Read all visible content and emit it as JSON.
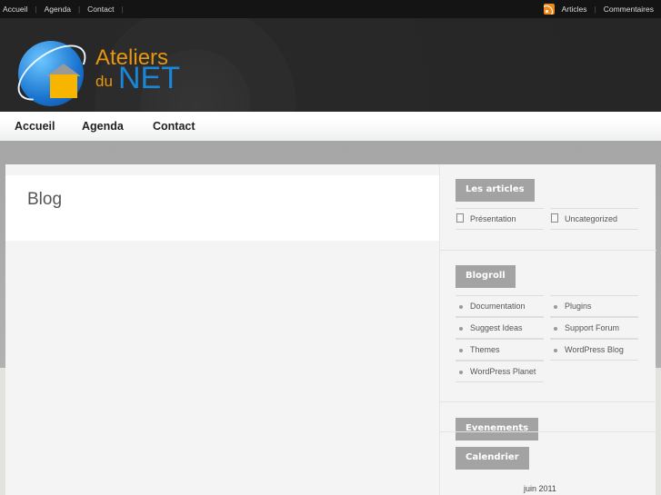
{
  "topbar": {
    "left": [
      "Accueil",
      "Agenda",
      "Contact"
    ],
    "right": [
      "Articles",
      "Commentaires"
    ]
  },
  "logo": {
    "line1": "Ateliers",
    "line2a": "du",
    "line2b": "NET"
  },
  "nav": [
    "Accueil",
    "Agenda",
    "Contact"
  ],
  "page": {
    "title": "Blog"
  },
  "sidebar": {
    "articles": {
      "title": "Les articles",
      "items": [
        "Présentation",
        "Uncategorized"
      ]
    },
    "blogroll": {
      "title": "Blogroll",
      "items": [
        "Documentation",
        "Plugins",
        "Suggest Ideas",
        "Support Forum",
        "Themes",
        "WordPress Blog",
        "WordPress Planet"
      ]
    },
    "evenements": {
      "title": "Evenements"
    },
    "calendrier": {
      "title": "Calendrier",
      "month": "juin 2011"
    }
  }
}
